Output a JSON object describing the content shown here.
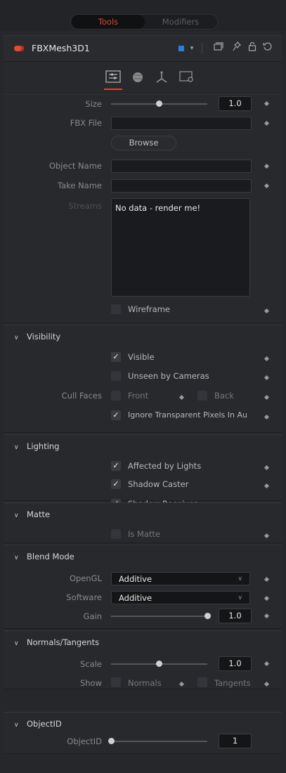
{
  "mode_tabs": {
    "tools": "Tools",
    "modifiers": "Modifiers"
  },
  "node": {
    "name": "FBXMesh3D1",
    "color_swatch": "#2f7fd8",
    "led_color": "#e74a33"
  },
  "header_icons": [
    "color-swatch-icon",
    "chevron-down-icon",
    "window-icon",
    "pin-icon",
    "lock-icon",
    "reset-icon"
  ],
  "inspector_tabs": [
    "controls-icon",
    "materials-icon",
    "transform-icon",
    "settings-icon"
  ],
  "controls": {
    "size_label": "Size",
    "size_value": "1.0",
    "size_fraction": 0.5,
    "fbx_file_label": "FBX File",
    "fbx_file_value": "",
    "browse_label": "Browse",
    "object_name_label": "Object Name",
    "object_name_value": "",
    "take_name_label": "Take Name",
    "take_name_value": "",
    "streams_label": "Streams",
    "streams_text": "No data - render me!",
    "wireframe_label": "Wireframe",
    "wireframe_checked": false
  },
  "visibility": {
    "title": "Visibility",
    "visible_label": "Visible",
    "visible_checked": true,
    "unseen_label": "Unseen by Cameras",
    "unseen_checked": false,
    "cull_faces_label": "Cull Faces",
    "front_label": "Front",
    "back_label": "Back",
    "ignore_label": "Ignore Transparent Pixels In Au",
    "ignore_checked": true
  },
  "lighting": {
    "title": "Lighting",
    "affected_label": "Affected by Lights",
    "shadow_caster_label": "Shadow Caster",
    "shadow_receiver_label": "Shadow Receiver"
  },
  "matte": {
    "title": "Matte",
    "is_matte_label": "Is Matte"
  },
  "blend_mode": {
    "title": "Blend Mode",
    "opengl_label": "OpenGL",
    "opengl_value": "Additive",
    "software_label": "Software",
    "software_value": "Additive",
    "gain_label": "Gain",
    "gain_value": "1.0",
    "gain_fraction": 1.0
  },
  "normals_tangents": {
    "title": "Normals/Tangents",
    "scale_label": "Scale",
    "scale_value": "1.0",
    "scale_fraction": 0.5,
    "show_label": "Show",
    "normals_label": "Normals",
    "tangents_label": "Tangents"
  },
  "object_id": {
    "title": "ObjectID",
    "object_id_label": "ObjectID",
    "object_id_value": "1",
    "object_id_fraction": 0.0
  }
}
